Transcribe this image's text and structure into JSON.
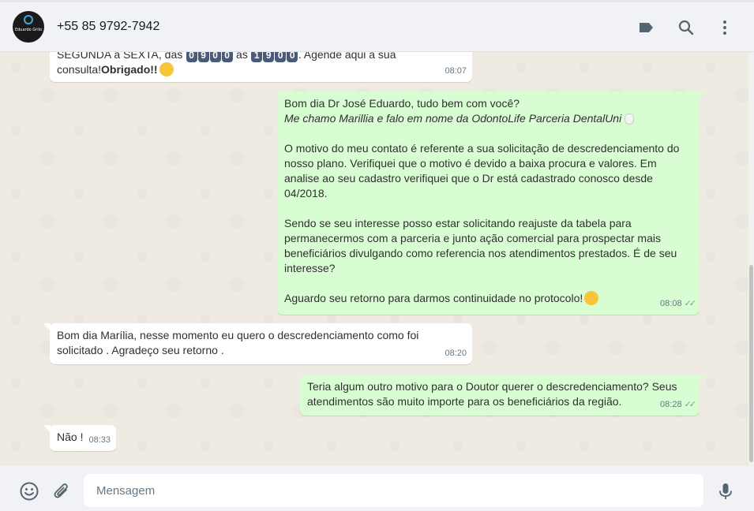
{
  "header": {
    "avatar_text": "Eduardo Grilo",
    "contact_name": "+55 85 9792-7942"
  },
  "messages": [
    {
      "direction": "in",
      "line1_prefix": "SEGUNDA à SEXTA, das ",
      "digits_start": [
        "0",
        "9",
        "0",
        "0"
      ],
      "line1_mid": " às ",
      "digits_end": [
        "1",
        "9",
        "0",
        "0"
      ],
      "line1_suffix": ". Agende aqui a sua",
      "line2_prefix": "consulta!",
      "line2_bold": "Obrigado!!",
      "time": "08:07"
    },
    {
      "direction": "out",
      "line1": "Bom dia Dr José Eduardo, tudo bem com você?",
      "line2_italic": "Me chamo Marillia e falo em nome da OdontoLife Parceria DentalUni",
      "para1": "O motivo do meu contato é referente a sua solicitação de descredenciamento do nosso plano. Verifiquei que o motivo é devido a baixa procura e valores. Em analise ao seu cadastro verifiquei que o Dr está cadastrado conosco desde 04/2018.",
      "para2": "Sendo se seu interesse posso estar solicitando reajuste da tabela para permanecermos com a parceria e junto ação comercial para prospectar mais beneficiários divulgando como referencia nos atendimentos prestados. É de seu interesse?",
      "para3": "Aguardo seu retorno para darmos continuidade no protocolo!",
      "time": "08:08"
    },
    {
      "direction": "in",
      "text": "Bom dia Marília, nesse momento eu quero o descredenciamento como foi solicitado . Agradeço seu retorno .",
      "time": "08:20"
    },
    {
      "direction": "out",
      "text": "Teria algum outro motivo para o Doutor querer o descredenciamento? Seus atendimentos são muito importe para os beneficiários da região.",
      "time": "08:28"
    },
    {
      "direction": "in",
      "text": "Não !",
      "time": "08:33"
    }
  ],
  "composer": {
    "placeholder": "Mensagem"
  },
  "icons": {
    "header": [
      "label-icon",
      "search-icon",
      "menu-icon"
    ],
    "footer": [
      "emoji-icon",
      "attach-icon",
      "mic-icon"
    ]
  },
  "colors": {
    "chat_bg": "#efeae2",
    "incoming": "#ffffff",
    "outgoing": "#d9fdd3",
    "bar": "#f0f2f5"
  }
}
